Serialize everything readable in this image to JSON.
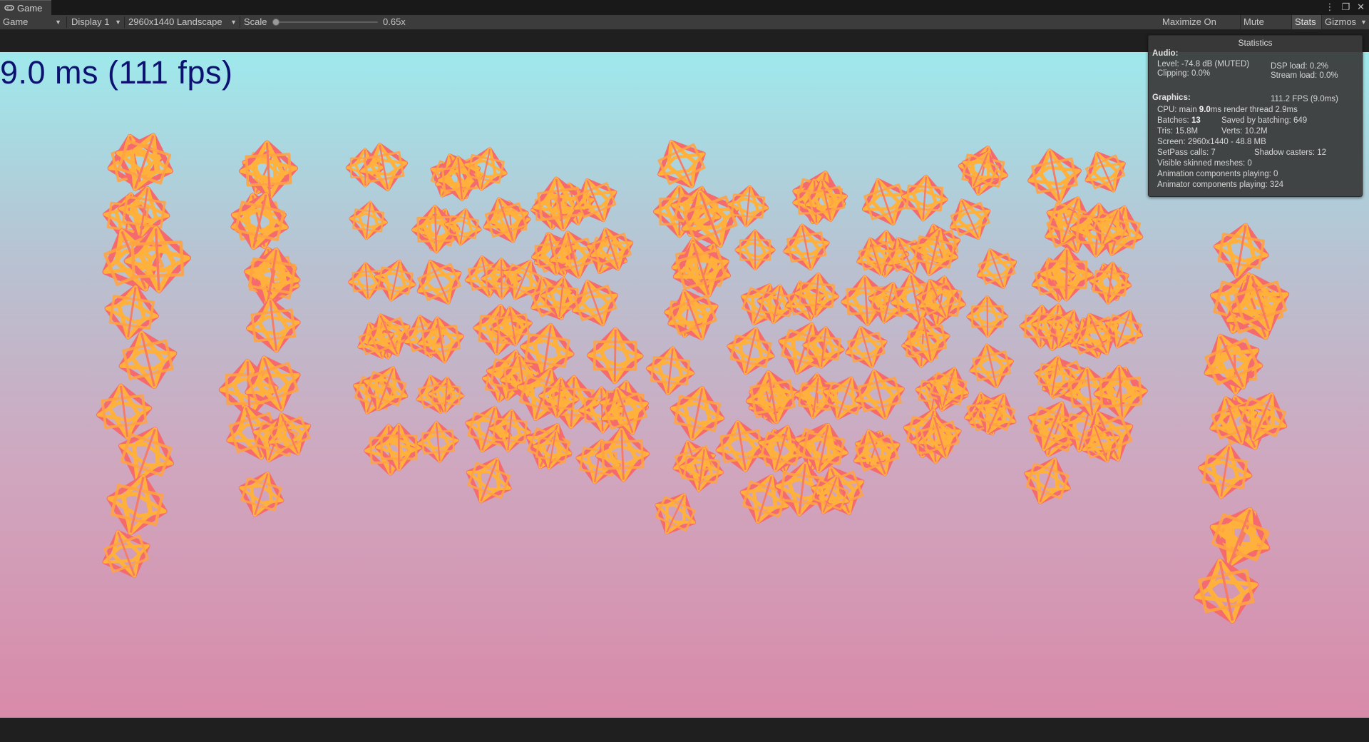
{
  "window": {
    "tab_label": "Game",
    "icons": [
      "gamepad-icon",
      "kebab-menu-icon",
      "maximize-icon",
      "close-icon"
    ]
  },
  "toolbar": {
    "mode_select": "Game",
    "display_select": "Display 1",
    "resolution_select": "2960x1440 Landscape",
    "scale_label": "Scale",
    "scale_value": "0.65x",
    "scale_level": 0.0,
    "maximize_on_play": "Maximize On Play",
    "mute_audio": "Mute Audio",
    "stats": "Stats",
    "gizmos": "Gizmos"
  },
  "viewport": {
    "fps_overlay": "9.0 ms (111 fps)",
    "sky_top_color": "#9ee9ec",
    "sky_bottom_color": "#d88aa9",
    "object_colors": [
      "#ffb13b",
      "#f56a6e"
    ]
  },
  "stats_panel": {
    "title": "Statistics",
    "audio_heading": "Audio:",
    "level": "Level: -74.8 dB (MUTED)",
    "dsp_load": "DSP load: 0.2%",
    "clipping": "Clipping: 0.0%",
    "stream_load": "Stream load: 0.0%",
    "graphics_heading": "Graphics:",
    "fps": "111.2 FPS (9.0ms)",
    "cpu_prefix": "CPU: main ",
    "cpu_main": "9.0",
    "cpu_suffix": "ms  render thread 2.9ms",
    "batches_prefix": "Batches: ",
    "batches": "13",
    "saved_by_batching": "Saved by batching: 649",
    "tris": "Tris: 15.8M",
    "verts": "Verts: 10.2M",
    "screen": "Screen: 2960x1440 - 48.8 MB",
    "setpass": "SetPass calls: 7",
    "shadow_casters": "Shadow casters: 12",
    "skinned_meshes": "Visible skinned meshes: 0",
    "animation_components": "Animation components playing: 0",
    "animator_components": "Animator components playing: 324"
  }
}
